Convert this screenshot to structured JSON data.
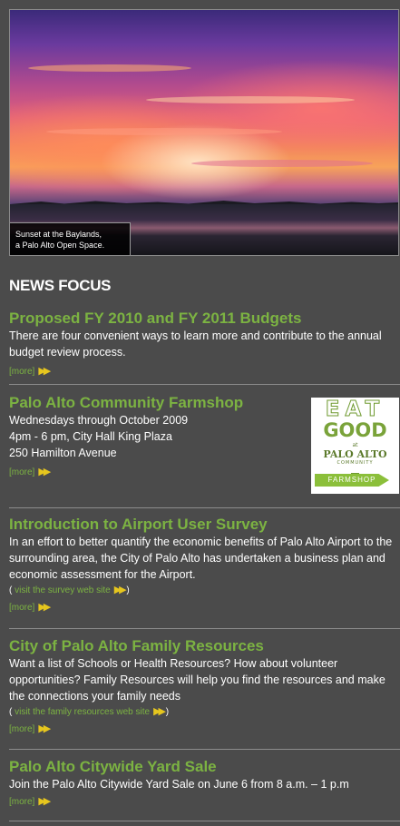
{
  "hero": {
    "caption_line1": "Sunset at the Baylands,",
    "caption_line2": "a Palo Alto Open Space."
  },
  "section_heading": "NEWS FOCUS",
  "items": [
    {
      "title": "Proposed FY 2010 and FY 2011 Budgets",
      "body": "There are four convenient ways to learn more and contribute to the annual budget review process.",
      "more": "[more]"
    },
    {
      "title": "Palo Alto Community Farmshop",
      "line1": "Wednesdays through October 2009",
      "line2": "4pm - 6 pm, City Hall King Plaza",
      "line3": "250 Hamilton Avenue",
      "more": "[more]",
      "logo": {
        "eat": "EAT",
        "good": "GOOD",
        "at": "at",
        "palo_alto": "PALO ALTO",
        "community": "COMMUNITY",
        "farmshop": "FARMSHOP"
      }
    },
    {
      "title": "Introduction to Airport User Survey",
      "body": "In an effort to better quantify the economic benefits of Palo Alto Airport to the surrounding area, the City of Palo Alto has undertaken a business plan and economic assessment for the Airport.",
      "link_open": "( ",
      "link_text": "visit the survey web site",
      "link_close": " )",
      "more": "[more]"
    },
    {
      "title": "City of Palo Alto Family Resources",
      "body": "Want a list of Schools or Health Resources?  How about volunteer opportunities? Family Resources will help you find the resources and make the connections your family needs",
      "link_open": "( ",
      "link_text": "visit the family resources web site",
      "link_close": " )",
      "more": "[more]"
    },
    {
      "title": "Palo Alto Citywide Yard Sale",
      "body": "Join the Palo Alto Citywide Yard Sale on June 6 from 8 a.m. – 1 p.m",
      "more": "[more]"
    }
  ],
  "icons": {
    "more_arrow": "double-chevron-right-icon"
  },
  "colors": {
    "background": "#4b4b4b",
    "title_green": "#7cb342",
    "arrow_yellow": "#e6c61e"
  }
}
